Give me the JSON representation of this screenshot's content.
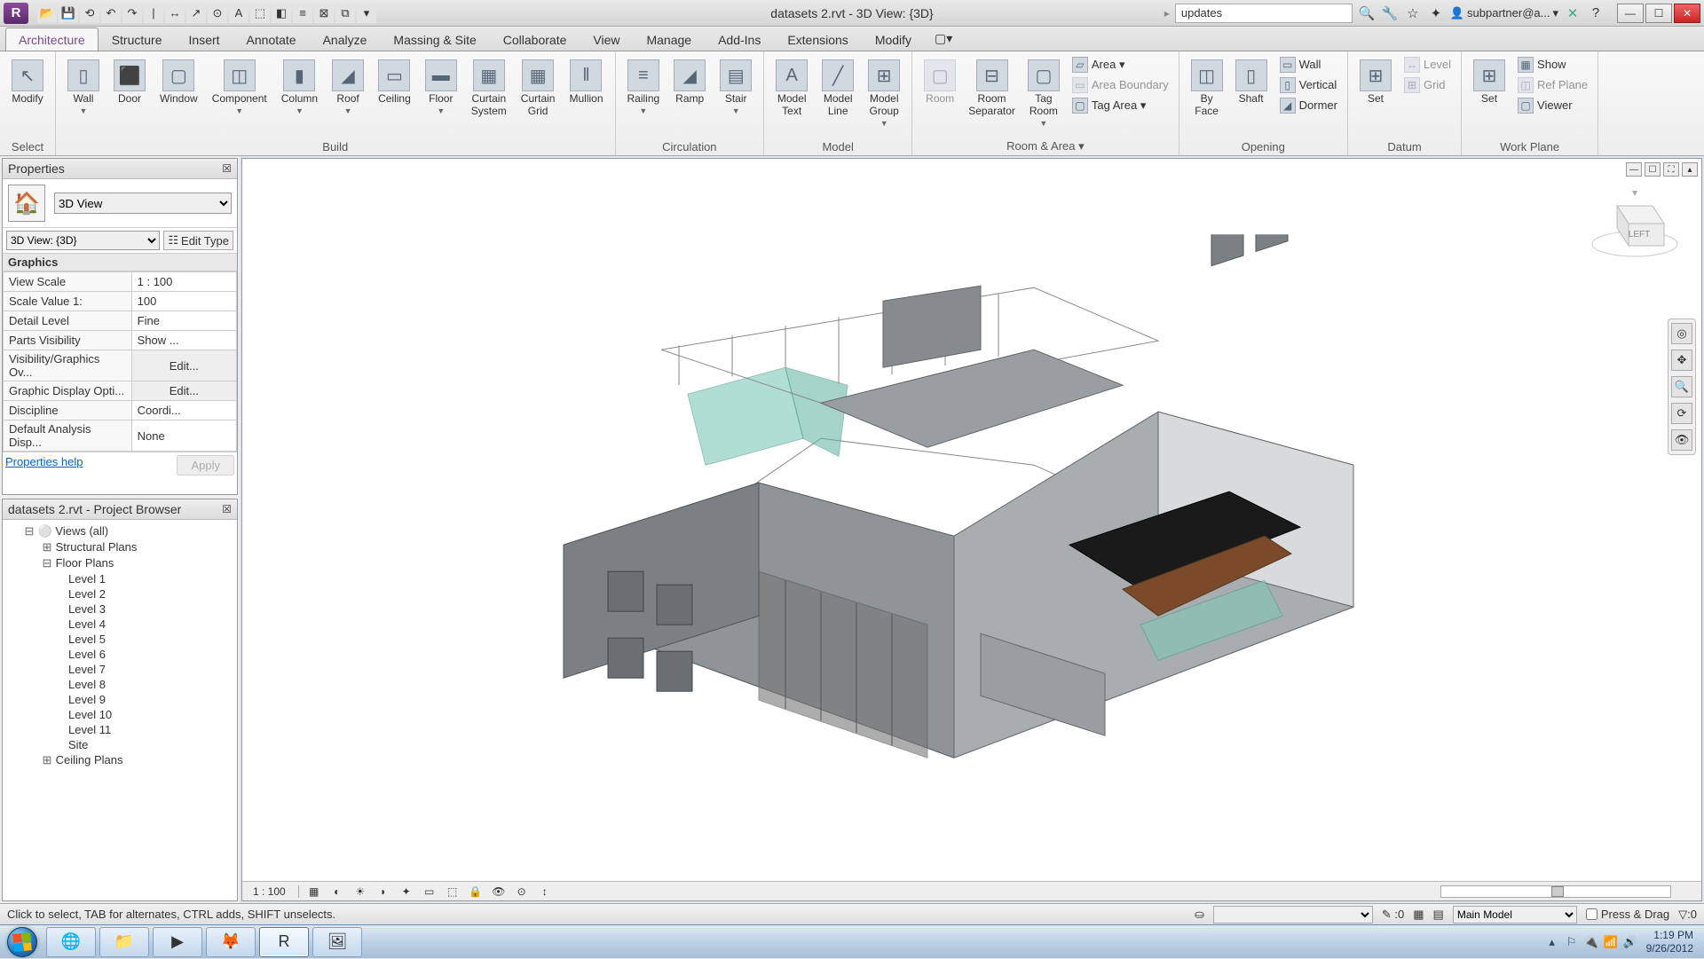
{
  "titlebar": {
    "app_letter": "R",
    "title": "datasets 2.rvt - 3D View: {3D}",
    "search_placeholder": "updates",
    "signin": "subpartner@a..."
  },
  "tabs": [
    "Architecture",
    "Structure",
    "Insert",
    "Annotate",
    "Analyze",
    "Massing & Site",
    "Collaborate",
    "View",
    "Manage",
    "Add-Ins",
    "Extensions",
    "Modify"
  ],
  "active_tab": 0,
  "ribbon": {
    "select": {
      "modify": "Modify",
      "label": "Select"
    },
    "build": {
      "label": "Build",
      "items": [
        "Wall",
        "Door",
        "Window",
        "Component",
        "Column",
        "Roof",
        "Ceiling",
        "Floor",
        "Curtain\nSystem",
        "Curtain\nGrid",
        "Mullion"
      ]
    },
    "circulation": {
      "label": "Circulation",
      "items": [
        "Railing",
        "Ramp",
        "Stair"
      ]
    },
    "model": {
      "label": "Model",
      "items": [
        "Model\nText",
        "Model\nLine",
        "Model\nGroup"
      ]
    },
    "room_area": {
      "label": "Room & Area ▾",
      "big": [
        "Room",
        "Room\nSeparator",
        "Tag\nRoom"
      ],
      "small": [
        "Area ▾",
        "Area Boundary",
        "Tag Area ▾"
      ]
    },
    "opening": {
      "label": "Opening",
      "big": [
        "By\nFace",
        "Shaft"
      ],
      "small": [
        "Wall",
        "Vertical",
        "Dormer"
      ]
    },
    "datum": {
      "label": "Datum",
      "big": [
        "Set"
      ],
      "small": [
        "Level",
        "Grid"
      ]
    },
    "work_plane": {
      "label": "Work Plane",
      "big": [
        "Set"
      ],
      "small": [
        "Show",
        "Ref Plane",
        "Viewer"
      ]
    }
  },
  "properties": {
    "title": "Properties",
    "type_name": "3D View",
    "instance_sel": "3D View: {3D}",
    "edit_type": "Edit Type",
    "section": "Graphics",
    "rows": [
      {
        "name": "View Scale",
        "value": "1 : 100"
      },
      {
        "name": "Scale Value   1:",
        "value": "100"
      },
      {
        "name": "Detail Level",
        "value": "Fine"
      },
      {
        "name": "Parts Visibility",
        "value": "Show ..."
      },
      {
        "name": "Visibility/Graphics Ov...",
        "value": "Edit...",
        "button": true
      },
      {
        "name": "Graphic Display Opti...",
        "value": "Edit...",
        "button": true
      },
      {
        "name": "Discipline",
        "value": "Coordi..."
      },
      {
        "name": "Default Analysis Disp...",
        "value": "None"
      }
    ],
    "help": "Properties help",
    "apply": "Apply"
  },
  "browser": {
    "title": "datasets 2.rvt - Project Browser",
    "root": "Views (all)",
    "groups": [
      {
        "name": "Structural Plans",
        "expanded": false
      },
      {
        "name": "Floor Plans",
        "expanded": true,
        "children": [
          "Level 1",
          "Level 2",
          "Level 3",
          "Level 4",
          "Level 5",
          "Level 6",
          "Level 7",
          "Level 8",
          "Level 9",
          "Level 10",
          "Level 11",
          "Site"
        ]
      },
      {
        "name": "Ceiling Plans",
        "expanded": false
      }
    ]
  },
  "viewcube_face": "LEFT",
  "viewbar": {
    "scale": "1 : 100"
  },
  "statusbar": {
    "hint": "Click to select, TAB for alternates, CTRL adds, SHIFT unselects.",
    "zero": ":0",
    "main_model": "Main Model",
    "press_drag": "Press & Drag",
    "filter": ":0"
  },
  "taskbar": {
    "time": "1:19 PM",
    "date": "9/26/2012"
  }
}
